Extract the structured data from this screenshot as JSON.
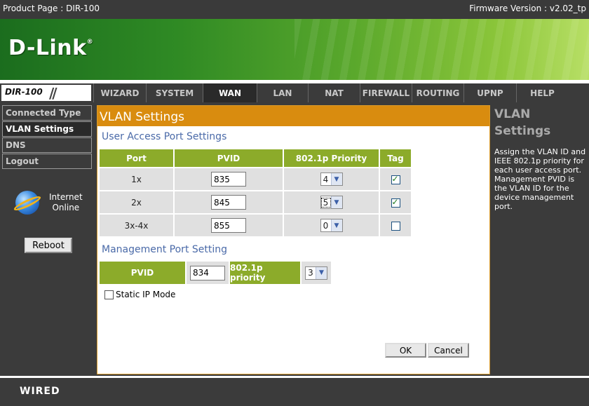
{
  "topbar": {
    "product": "Product Page : DIR-100",
    "firmware": "Firmware Version : v2.02_tp"
  },
  "brand": {
    "logo": "D-Link",
    "trademark": "®"
  },
  "nav": {
    "model": "DIR-100",
    "tabs": [
      "WIZARD",
      "SYSTEM",
      "WAN",
      "LAN",
      "NAT",
      "FIREWALL",
      "ROUTING",
      "UPNP",
      "HELP"
    ],
    "active_tab": "WAN"
  },
  "sidebar": {
    "items": [
      "Connected Type",
      "VLAN Settings",
      "DNS",
      "Logout"
    ],
    "active_item": "VLAN Settings",
    "status_line1": "Internet",
    "status_line2": "Online",
    "reboot_label": "Reboot"
  },
  "main": {
    "title": "VLAN Settings",
    "user_section_title": "User Access Port Settings",
    "table_headers": [
      "Port",
      "PVID",
      "802.1p Priority",
      "Tag"
    ],
    "rows": [
      {
        "port": "1x",
        "pvid": "835",
        "priority": "4",
        "tag": true
      },
      {
        "port": "2x",
        "pvid": "845",
        "priority": "5",
        "tag": true
      },
      {
        "port": "3x-4x",
        "pvid": "855",
        "priority": "0",
        "tag": false
      }
    ],
    "mgmt_section_title": "Management Port Setting",
    "mgmt": {
      "pvid_label": "PVID",
      "pvid_value": "834",
      "priority_label": "802.1p priority",
      "priority_value": "3"
    },
    "static_ip_label": "Static IP Mode",
    "static_ip_checked": false,
    "ok_label": "OK",
    "cancel_label": "Cancel"
  },
  "help": {
    "title_line1": "VLAN",
    "title_line2": "Settings",
    "text": "Assign the VLAN ID and IEEE 802.1p priority for each user access port. Management PVID is the VLAN ID for the device management port."
  },
  "footer": {
    "label": "WIRED"
  },
  "colors": {
    "accent_orange": "#d98c0f",
    "header_green": "#8cab2a",
    "section_blue": "#4a6aa8",
    "panel_gray": "#3b3b3b"
  }
}
